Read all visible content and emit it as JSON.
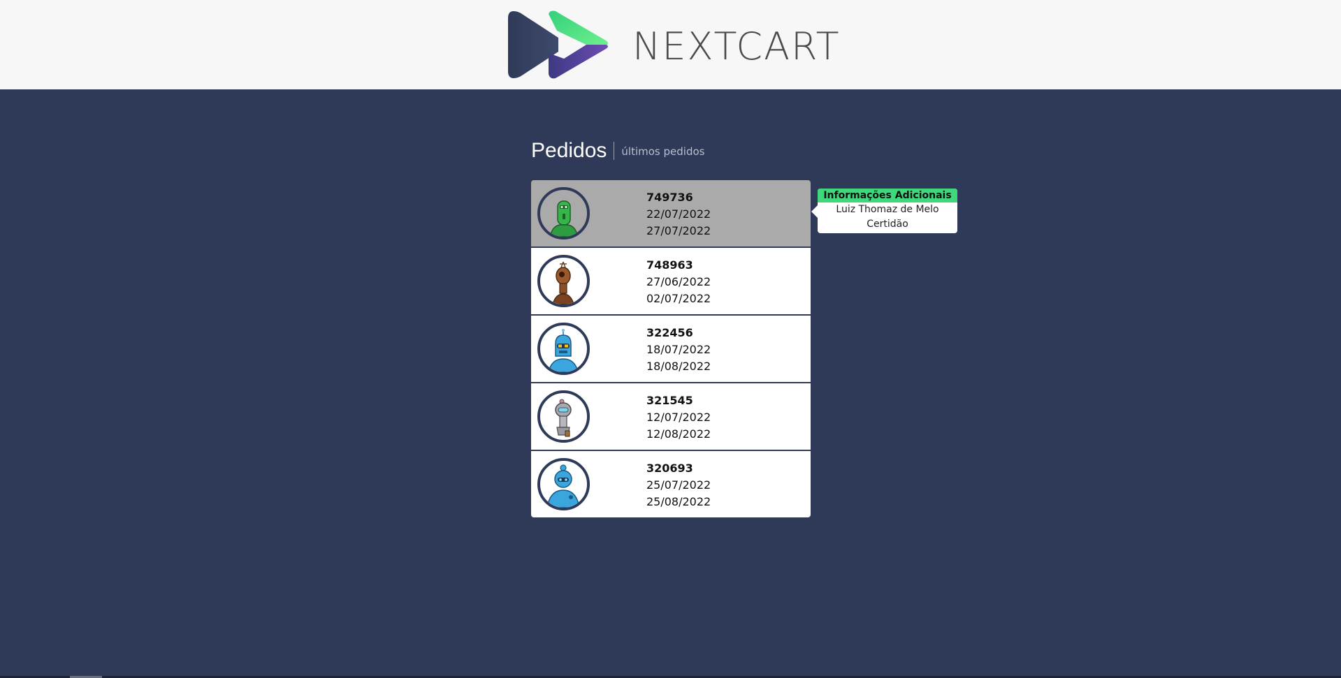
{
  "brand": {
    "name": "NEXTCART"
  },
  "section": {
    "title": "Pedidos",
    "subtitle": "últimos pedidos"
  },
  "orders": [
    {
      "id": "749736",
      "date1": "22/07/2022",
      "date2": "27/07/2022",
      "avatar": "green-robot-icon",
      "active": true
    },
    {
      "id": "748963",
      "date1": "27/06/2022",
      "date2": "02/07/2022",
      "avatar": "brown-robot-icon",
      "active": false
    },
    {
      "id": "322456",
      "date1": "18/07/2022",
      "date2": "18/08/2022",
      "avatar": "blue-robot-icon",
      "active": false
    },
    {
      "id": "321545",
      "date1": "12/07/2022",
      "date2": "12/08/2022",
      "avatar": "grey-robot-icon",
      "active": false
    },
    {
      "id": "320693",
      "date1": "25/07/2022",
      "date2": "25/08/2022",
      "avatar": "teal-robot-icon",
      "active": false
    }
  ],
  "tooltip": {
    "title": "Informações Adicionais",
    "name": "Luiz Thomaz de Melo",
    "document": "Certidão"
  },
  "colors": {
    "background": "#2f3a58",
    "header": "#f7f7f7",
    "accent_green": "#3fd87c",
    "active_row": "#aaaaaa"
  }
}
